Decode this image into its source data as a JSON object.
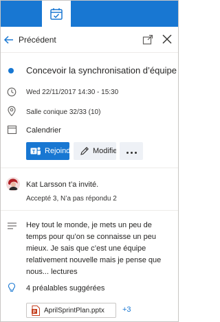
{
  "nav": {
    "back_label": "Précédent"
  },
  "event": {
    "title": "Concevoir la synchronisation d’équipe",
    "datetime": "Wed 22/11/2017 14:30 - 15:30",
    "location": "Salle conique 32/33 (10)",
    "calendar": "Calendrier"
  },
  "actions": {
    "join_label": "Rejoindre",
    "modify_label": "Modifier"
  },
  "attendees": {
    "inviter": "Kat Larsson t’a invité.",
    "responses": "Accepté 3, N’a pas répondu 2"
  },
  "description": {
    "text": "Hey tout le monde, je mets un peu de temps pour qu’on se connaisse un peu mieux. Je sais que c’est une équipe relativement nouvelle mais je pense que nous... lectures"
  },
  "prereads": {
    "label": "4 préalables suggérées",
    "file_name": "AprilSprintPlan.pptx",
    "more_count": "+3"
  },
  "colors": {
    "accent": "#1877d2",
    "file_icon": "#c43e1c"
  },
  "icons": {
    "top_tab": "calendar-check-icon",
    "back": "arrow-left-icon",
    "popout": "popout-icon",
    "close": "close-icon",
    "clock": "clock-icon",
    "location": "location-pin-icon",
    "calendar": "calendar-icon",
    "teams": "teams-icon",
    "edit": "pencil-icon",
    "more": "more-horizontal-icon",
    "notes": "text-lines-icon",
    "suggestions": "lightbulb-icon",
    "file": "powerpoint-file-icon"
  }
}
